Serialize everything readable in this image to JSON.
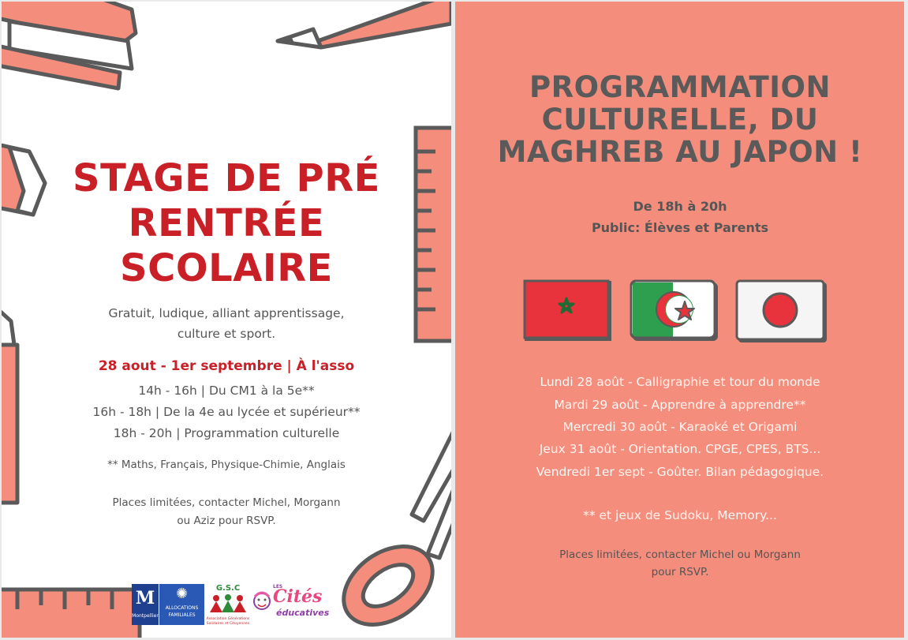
{
  "left": {
    "title_lines": [
      "STAGE DE PRÉ",
      "RENTRÉE",
      "SCOLAIRE"
    ],
    "intro_lines": [
      "Gratuit, ludique, alliant apprentissage,",
      "culture et sport."
    ],
    "dates_line": "28 aout - 1er septembre | À l'asso",
    "schedule": [
      "14h - 16h | Du CM1 à la 5e**",
      "16h - 18h | De la 4e au lycée et supérieur**",
      "18h - 20h | Programmation culturelle"
    ],
    "subjects_note": "** Maths, Français, Physique-Chimie, Anglais",
    "places_lines": [
      "Places limitées, contacter Michel, Morgann",
      "ou Aziz pour RSVP."
    ],
    "logos": {
      "montpellier_letter": "M",
      "montpellier_name": "Montpellier",
      "caf_line1": "ALLOCATIONS",
      "caf_line2": "FAMILIALES",
      "agsc_letters": "G.S.C",
      "agsc_caption1": "Association Générations",
      "agsc_caption2": "Solidaires et Citoyennes",
      "cites_small": "LES",
      "cites_main": "Cités",
      "cites_sub": "éducatives"
    }
  },
  "right": {
    "title_lines": [
      "PROGRAMMATION",
      "CULTURELLE, DU",
      "MAGHREB AU JAPON !"
    ],
    "time_lines": [
      "De 18h à 20h",
      "Public: Élèves et Parents"
    ],
    "flags": [
      "morocco-flag",
      "algeria-flag",
      "japan-flag"
    ],
    "program": [
      "Lundi 28 août - Calligraphie et tour du monde",
      "Mardi 29 août - Apprendre à apprendre**",
      "Mercredi 30 août - Karaoké et Origami",
      "Jeux 31 août - Orientation. CPGE, CPES, BTS...",
      "Vendredi 1er sept - Goûter. Bilan pédagogique."
    ],
    "note": "** et jeux de Sudoku, Memory...",
    "places_lines": [
      "Places limitées, contacter Michel ou Morgann",
      "pour RSVP."
    ]
  },
  "colors": {
    "accent_red": "#c92027",
    "salmon": "#f58d7c",
    "outline_gray": "#5a5a5a",
    "text_gray": "#555555"
  }
}
